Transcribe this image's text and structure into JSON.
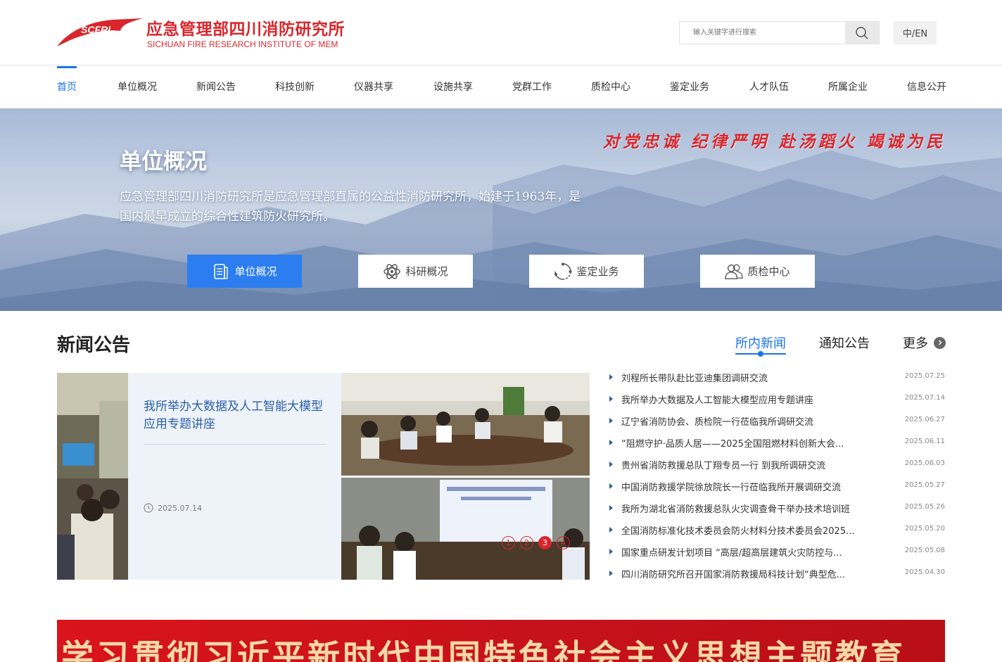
{
  "header": {
    "logo_text": "SCFRI",
    "org_name_cn": "应急管理部四川消防研究所",
    "org_name_en": "SICHUAN FIRE RESEARCH INSTITUTE OF MEM",
    "search_placeholder": "输入关键字进行搜索",
    "lang_label": "中/EN",
    "brand_color": "#d8262c"
  },
  "nav": {
    "items": [
      "首页",
      "单位概况",
      "新闻公告",
      "科技创新",
      "仪器共享",
      "设施共享",
      "党群工作",
      "质检中心",
      "鉴定业务",
      "人才队伍",
      "所属企业",
      "信息公开"
    ],
    "active_index": 0,
    "accent": "#1a73e8"
  },
  "banner": {
    "slogan": "对党忠诚 纪律严明 赴汤蹈火 竭诚为民",
    "title": "单位概况",
    "description": "应急管理部四川消防研究所是应急管理部直属的公益性消防研究所，始建于1963年，是国内最早成立的综合性建筑防火研究所。",
    "buttons": [
      {
        "label": "单位概况",
        "icon": "document-icon",
        "active": true
      },
      {
        "label": "科研概况",
        "icon": "atom-icon",
        "active": false
      },
      {
        "label": "鉴定业务",
        "icon": "refresh-icon",
        "active": false
      },
      {
        "label": "质检中心",
        "icon": "users-icon",
        "active": false
      }
    ]
  },
  "news": {
    "section_title": "新闻公告",
    "tabs": [
      "所内新闻",
      "通知公告"
    ],
    "active_tab": 0,
    "more_label": "更多",
    "featured": {
      "title": "我所举办大数据及人工智能大模型应用专题讲座",
      "date": "2025.07.14"
    },
    "carousel_pages": [
      "1",
      "2",
      "3",
      "4"
    ],
    "carousel_active": 2,
    "items": [
      {
        "title": "刘程所长带队赴比亚迪集团调研交流",
        "date": "2025.07.25"
      },
      {
        "title": "我所举办大数据及人工智能大模型应用专题讲座",
        "date": "2025.07.14"
      },
      {
        "title": "辽宁省消防协会、质检院一行莅临我所调研交流",
        "date": "2025.06.27"
      },
      {
        "title": "“阻燃守护·品质人居——2025全国阻燃材料创新大会...",
        "date": "2025.06.11"
      },
      {
        "title": "贵州省消防救援总队丁翔专员一行 到我所调研交流",
        "date": "2025.06.03"
      },
      {
        "title": "中国消防救援学院徐放院长一行莅临我所开展调研交流",
        "date": "2025.05.27"
      },
      {
        "title": "我所为湖北省消防救援总队火灾调查骨干举办技术培训班",
        "date": "2025.05.26"
      },
      {
        "title": "全国消防标准化技术委员会防火材料分技术委员会2025...",
        "date": "2025.05.20"
      },
      {
        "title": "国家重点研发计划项目 “高层/超高层建筑火灾防控与...",
        "date": "2025.05.08"
      },
      {
        "title": "四川消防研究所召开国家消防救援局科技计划“典型危...",
        "date": "2025.04.30"
      }
    ]
  },
  "red_banner": {
    "text": "学习贯彻习近平新时代中国特色社会主义思想主题教育"
  }
}
